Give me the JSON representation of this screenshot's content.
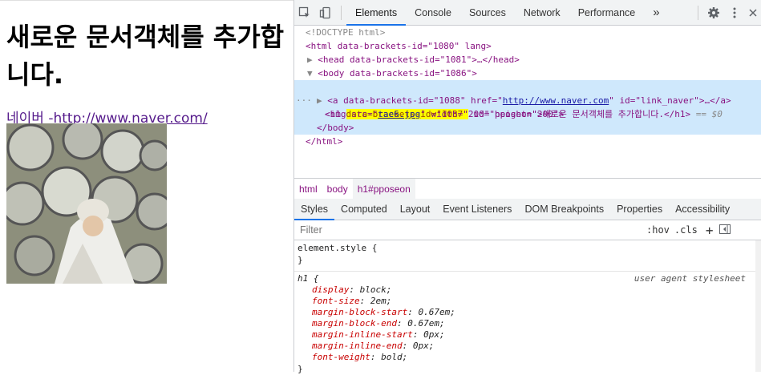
{
  "page": {
    "heading": "새로운 문서객체를 추가합니다.",
    "link_text": "네이버 -http://www.naver.com/"
  },
  "devtools": {
    "tabs": [
      "Elements",
      "Console",
      "Sources",
      "Network",
      "Performance"
    ],
    "more": "»",
    "dom_lines": {
      "doctype": "<!DOCTYPE html>",
      "html_open": "<html data-brackets-id=\"1080\" lang>",
      "head": "<head data-brackets-id=\"1081\">…</head>",
      "body_open": "<body data-brackets-id=\"1086\">",
      "h1_prefix": "<h1 ",
      "h1_hl": "data-brackets-id=\"1087\"",
      "h1_mid": " id=\"pposeon\">새로운 문서객체를 추가합니다.</h1>",
      "h1_suffix": " == $0",
      "a_prefix": "<a data-brackets-id=\"1088\" href=\"",
      "a_href": "http://www.naver.com",
      "a_suffix": "\" id=\"link_naver\">…</a>",
      "img_prefix": "<img src=\"",
      "img_src": "tae6.jpg",
      "img_suffix": "\" width=\"200\" height=\"200\">",
      "body_close": "</body>",
      "html_close": "</html>"
    },
    "breadcrumbs": [
      "html",
      "body",
      "h1#pposeon"
    ],
    "subtabs": [
      "Styles",
      "Computed",
      "Layout",
      "Event Listeners",
      "DOM Breakpoints",
      "Properties",
      "Accessibility"
    ],
    "filter_placeholder": "Filter",
    "hov": ":hov",
    "cls": ".cls",
    "element_style": "element.style {",
    "close_brace": "}",
    "h1_selector": "h1 {",
    "ua_label": "user agent stylesheet",
    "props": [
      {
        "name": "display",
        "value": "block;"
      },
      {
        "name": "font-size",
        "value": "2em;"
      },
      {
        "name": "margin-block-start",
        "value": "0.67em;"
      },
      {
        "name": "margin-block-end",
        "value": "0.67em;"
      },
      {
        "name": "margin-inline-start",
        "value": "0px;"
      },
      {
        "name": "margin-inline-end",
        "value": "0px;"
      },
      {
        "name": "font-weight",
        "value": "bold;"
      }
    ]
  }
}
